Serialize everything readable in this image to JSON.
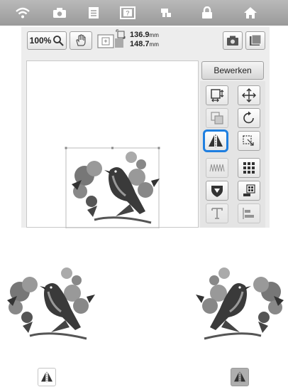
{
  "topbar": {
    "icons": [
      "wifi-icon",
      "camera-icon",
      "document-icon",
      "help-icon",
      "sewing-icon",
      "lock-icon",
      "home-icon"
    ]
  },
  "toolbar": {
    "zoom_label": "100%",
    "size_width": "136.9",
    "size_height": "148.7",
    "size_unit": "mm"
  },
  "side_panel": {
    "edit_label": "Bewerken",
    "tools": [
      "resize",
      "move",
      "group",
      "rotate",
      "mirror",
      "density",
      "border",
      "array",
      "applique",
      "color-sort",
      "text",
      "align"
    ]
  },
  "colors": {
    "selection": "#1f7fe0",
    "topbar": "#a9a9a9"
  }
}
